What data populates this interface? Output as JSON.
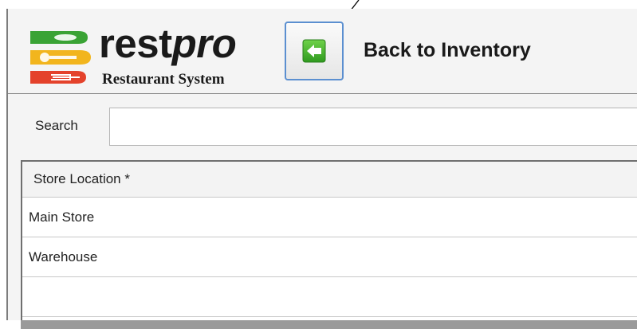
{
  "logo": {
    "word_main": "rest",
    "word_accent": "pro",
    "subtitle": "Restaurant System",
    "colors": [
      "#3aa335",
      "#f2b51d",
      "#e4422b"
    ]
  },
  "header": {
    "back_button_icon": "arrow-left-icon",
    "title": "Back to Inventory"
  },
  "search": {
    "label": "Search",
    "value": "",
    "placeholder": ""
  },
  "table": {
    "column_header": "Store Location *",
    "rows": [
      "Main Store",
      "Warehouse",
      ""
    ]
  }
}
